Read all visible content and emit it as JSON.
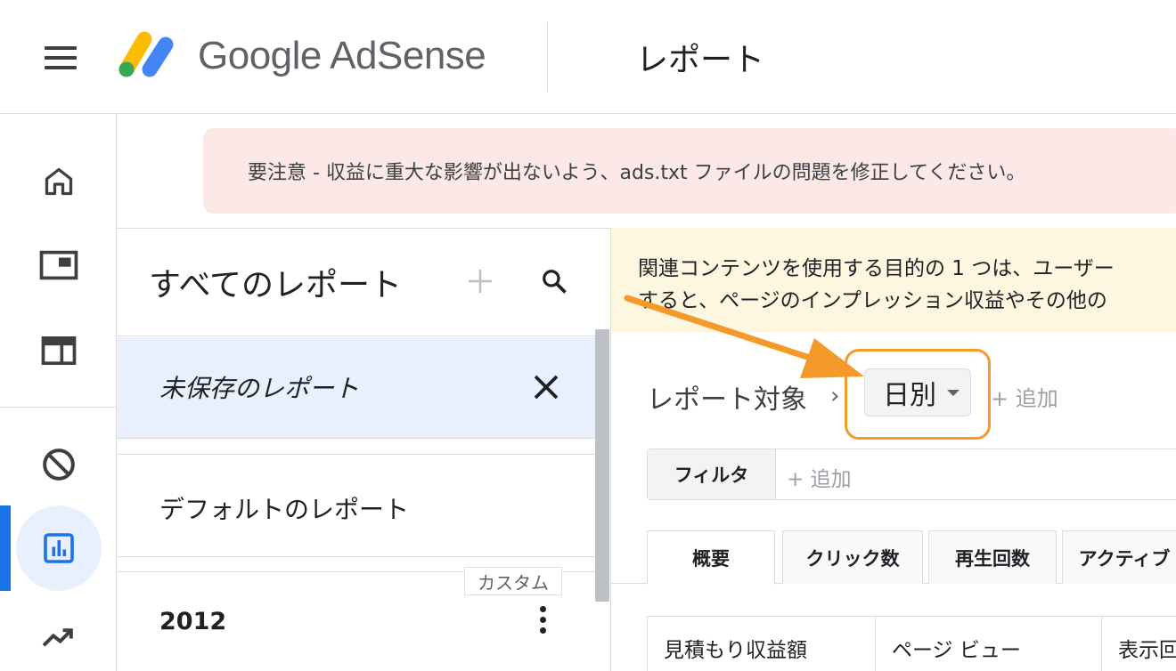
{
  "header": {
    "logo_text": "Google AdSense",
    "page_title": "レポート"
  },
  "alert": {
    "text": "要注意 - 収益に重大な影響が出ないよう、ads.txt ファイルの問題を修正してください。"
  },
  "rail": {
    "items": [
      {
        "icon": "home-icon"
      },
      {
        "icon": "ads-icon"
      },
      {
        "icon": "layout-icon"
      },
      {
        "icon": "block-icon"
      },
      {
        "icon": "reports-icon",
        "active": true
      },
      {
        "icon": "trending-icon"
      }
    ]
  },
  "report_list": {
    "title": "すべてのレポート",
    "items": [
      {
        "label": "未保存のレポート",
        "selected": true
      },
      {
        "label": "デフォルトのレポート"
      },
      {
        "label": "2012",
        "tag": "カスタム"
      }
    ]
  },
  "info": {
    "line1": "関連コンテンツを使用する目的の 1 つは、ユーザー",
    "line2": "すると、ページのインプレッション収益やその他の"
  },
  "dimension": {
    "label": "レポート対象",
    "chevron": "›",
    "selected": "日別",
    "add": "+ 追加"
  },
  "filter": {
    "label": "フィルタ",
    "add": "+ 追加"
  },
  "tabs": [
    "概要",
    "クリック数",
    "再生回数",
    "アクティブ"
  ],
  "table": {
    "headers": [
      "見積もり収益額",
      "ページ ビュー",
      "表示回"
    ]
  },
  "colors": {
    "accent_blue": "#1a73e8",
    "highlight_orange": "#f39a2b",
    "alert_bg": "#fce8e6",
    "info_bg": "#fef7e0"
  }
}
